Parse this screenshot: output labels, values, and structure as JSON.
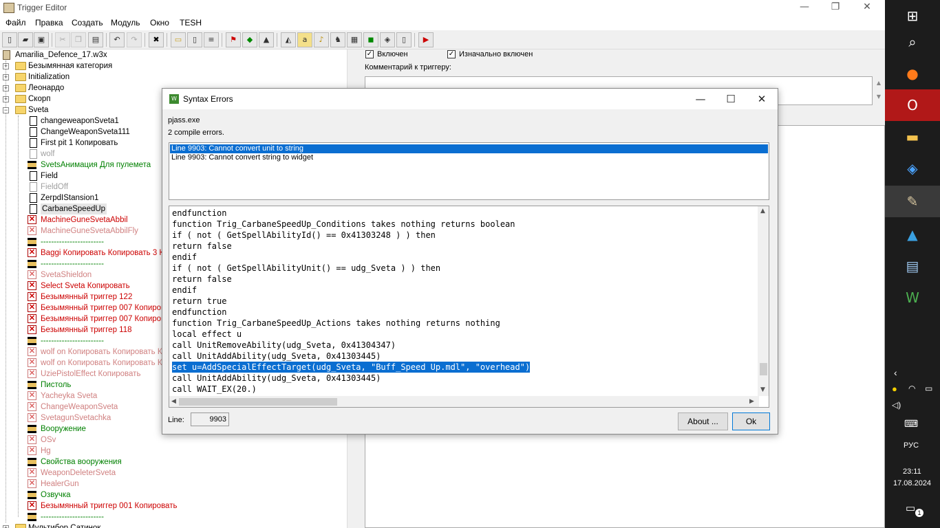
{
  "window": {
    "title": "Trigger Editor",
    "minimize": "—",
    "restore": "❐",
    "close": "✕"
  },
  "menu": [
    "Файл",
    "Правка",
    "Создать",
    "Модуль",
    "Окно",
    "TESH"
  ],
  "tree": {
    "root": "Amarilia_Defence_17.w3x",
    "items": [
      {
        "text": "Безымянная категория",
        "type": "folder",
        "color": "#000000"
      },
      {
        "text": "Initialization",
        "type": "folder",
        "color": "#000000"
      },
      {
        "text": "Леонардо",
        "type": "folder",
        "color": "#000000"
      },
      {
        "text": "Скорп",
        "type": "folder",
        "color": "#000000"
      },
      {
        "text": "Sveta",
        "type": "folder-open",
        "color": "#000000"
      },
      {
        "text": "changeweaponSveta1",
        "type": "doc",
        "color": "#000000"
      },
      {
        "text": "ChangeWeaponSveta111",
        "type": "doc",
        "color": "#000000"
      },
      {
        "text": "First pit 1 Копировать",
        "type": "doc",
        "color": "#000000"
      },
      {
        "text": "wolf",
        "type": "doc-gray",
        "color": "#a0a0a0"
      },
      {
        "text": "SvetsАнимация Для пулемета",
        "type": "comment",
        "color": "#008000"
      },
      {
        "text": "Field",
        "type": "doc",
        "color": "#000000"
      },
      {
        "text": "FieldOff",
        "type": "doc-gray",
        "color": "#a0a0a0"
      },
      {
        "text": "ZerpdIStansion1",
        "type": "doc",
        "color": "#000000"
      },
      {
        "text": "CarbaneSpeedUp",
        "type": "doc",
        "color": "#000000",
        "selected": true
      },
      {
        "text": "MachineGuneSvetaAbbil",
        "type": "x",
        "color": "#cc0000"
      },
      {
        "text": "MachineGuneSvetaAbbilFly",
        "type": "x-gray",
        "color": "#d08080"
      },
      {
        "text": "------------------------",
        "type": "comment",
        "color": "#008000"
      },
      {
        "text": "Baggi Копировать Копировать 3 Ко",
        "type": "x",
        "color": "#cc0000"
      },
      {
        "text": "------------------------",
        "type": "comment",
        "color": "#008000"
      },
      {
        "text": "SvetaShieldon",
        "type": "x-gray",
        "color": "#d08080"
      },
      {
        "text": "Select Sveta Копировать",
        "type": "x",
        "color": "#cc0000"
      },
      {
        "text": "Безымянный триггер 122",
        "type": "x",
        "color": "#cc0000"
      },
      {
        "text": "Безымянный триггер 007 Копиров",
        "type": "x",
        "color": "#cc0000"
      },
      {
        "text": "Безымянный триггер 007 Копиров",
        "type": "x",
        "color": "#cc0000"
      },
      {
        "text": "Безымянный триггер 118",
        "type": "x",
        "color": "#cc0000"
      },
      {
        "text": "------------------------",
        "type": "comment",
        "color": "#008000"
      },
      {
        "text": "wolf on Копировать Копировать Ко",
        "type": "x-gray",
        "color": "#d08080"
      },
      {
        "text": "wolf on Копировать Копировать Ко",
        "type": "x-gray",
        "color": "#d08080"
      },
      {
        "text": "UziePistolEffect Копировать",
        "type": "x-gray",
        "color": "#d08080"
      },
      {
        "text": "Пистоль",
        "type": "comment",
        "color": "#008000"
      },
      {
        "text": "Yacheyka Sveta",
        "type": "x-gray",
        "color": "#d08080"
      },
      {
        "text": "ChangeWeaponSveta",
        "type": "x-gray",
        "color": "#d08080"
      },
      {
        "text": "SvetagunSvetachka",
        "type": "x-gray",
        "color": "#d08080"
      },
      {
        "text": "Вооружение",
        "type": "comment",
        "color": "#008000"
      },
      {
        "text": "OSv",
        "type": "x-gray",
        "color": "#d08080"
      },
      {
        "text": "Hg",
        "type": "x-gray",
        "color": "#d08080"
      },
      {
        "text": "Свойства вооружения",
        "type": "comment",
        "color": "#008000"
      },
      {
        "text": "WeaponDeleterSveta",
        "type": "x-gray",
        "color": "#d08080"
      },
      {
        "text": "HealerGun",
        "type": "x-gray",
        "color": "#d08080"
      },
      {
        "text": "Озвучка",
        "type": "comment",
        "color": "#008000"
      },
      {
        "text": "Безымянный триггер 001 Копировать",
        "type": "x",
        "color": "#cc0000"
      },
      {
        "text": "------------------------",
        "type": "comment",
        "color": "#008000"
      },
      {
        "text": "Мультибор Сатинок",
        "type": "folder",
        "color": "#000000"
      }
    ]
  },
  "right": {
    "enabled_label": "Включен",
    "initially_label": "Изначально включен",
    "comment_label": "Комментарий к триггеру:"
  },
  "dialog": {
    "title": "Syntax Errors",
    "exe": "pjass.exe",
    "count": "2 compile errors.",
    "errors": [
      "Line 9903:  Cannot convert unit to string",
      "Line 9903:  Cannot convert string to widget"
    ],
    "code": [
      "endfunction",
      "function Trig_CarbaneSpeedUp_Conditions takes nothing returns boolean",
      "if ( not ( GetSpellAbilityId() == 0x41303248 ) ) then",
      "return false",
      "endif",
      "if ( not ( GetSpellAbilityUnit() == udg_Sveta ) ) then",
      "return false",
      "endif",
      "return true",
      "endfunction",
      "function Trig_CarbaneSpeedUp_Actions takes nothing returns nothing",
      "local effect u",
      "call UnitRemoveAbility(udg_Sveta, 0x41304347)",
      "call UnitAddAbility(udg_Sveta, 0x41303445)",
      "set u=AddSpecialEffectTarget(udg_Sveta, \"Buff_Speed Up.mdl\", \"overhead\")",
      "call UnitAddAbility(udg_Sveta, 0x41303445)",
      "call WAIT_EX(20.)"
    ],
    "selected_line": 14,
    "line_label": "Line:",
    "line_value": "9903",
    "about_label": "About ...",
    "ok_label": "Ok"
  },
  "taskbar": {
    "lang": "РУС",
    "time": "23:11",
    "date": "17.08.2024",
    "notif_count": "1"
  },
  "colors": {
    "selection": "#0a6ed1",
    "taskbar": "#1c1c1c",
    "enabled_trigger": "#008000",
    "error_trigger": "#cc0000"
  }
}
